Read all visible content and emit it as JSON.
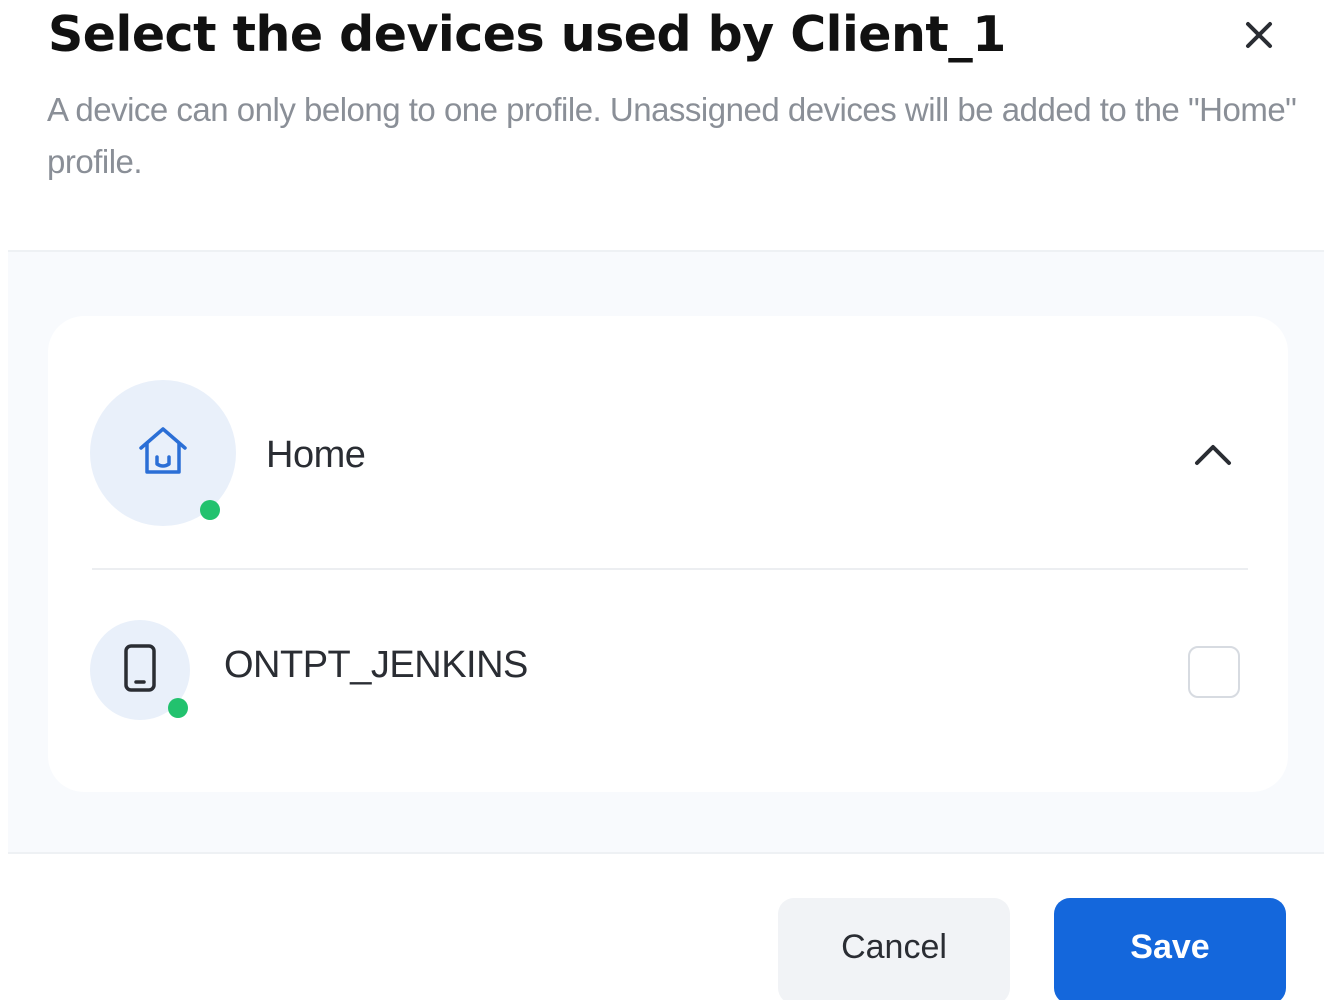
{
  "dialog": {
    "title": "Select the devices used by Client_1",
    "subtitle": "A device can only belong to one profile. Unassigned devices will be added to the \"Home\" profile.",
    "close_icon": "close-icon"
  },
  "profile": {
    "name": "Home",
    "icon": "home-icon",
    "status": "online",
    "expanded": true,
    "chevron_icon": "chevron-up-icon",
    "devices": [
      {
        "name": "ONTPT_JENKINS",
        "icon": "smartphone-icon",
        "status": "online",
        "checked": false
      }
    ]
  },
  "footer": {
    "cancel_label": "Cancel",
    "save_label": "Save"
  },
  "colors": {
    "accent": "#1467dc",
    "status_online": "#22c26e",
    "icon_blue": "#2b6fd6",
    "avatar_bg": "#e9f0fa",
    "content_bg": "#f8fafd"
  }
}
